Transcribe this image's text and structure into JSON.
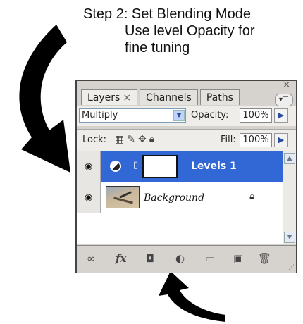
{
  "instructions": {
    "line1": "Step 2: Set Blending Mode",
    "line2": "Use level Opacity for",
    "line3": "fine tuning"
  },
  "panel": {
    "tabs": [
      {
        "label": "Layers",
        "close": "×"
      },
      {
        "label": "Channels"
      },
      {
        "label": "Paths"
      }
    ],
    "window_controls": "– ×",
    "blend_mode": "Multiply",
    "opacity_label": "Opacity:",
    "opacity_value": "100%",
    "lock_label": "Lock:",
    "fill_label": "Fill:",
    "fill_value": "100%",
    "layers": [
      {
        "name": "Levels 1",
        "selected": true
      },
      {
        "name": "Background",
        "locked": true
      }
    ],
    "bottom_icons": [
      "link-layers-icon",
      "fx-icon",
      "layer-mask-icon",
      "adjustment-layer-icon",
      "group-folder-icon",
      "new-layer-icon",
      "trash-icon"
    ]
  },
  "colors": {
    "selected_layer": "#3168d5",
    "panel_bg": "#d6d3ce"
  }
}
